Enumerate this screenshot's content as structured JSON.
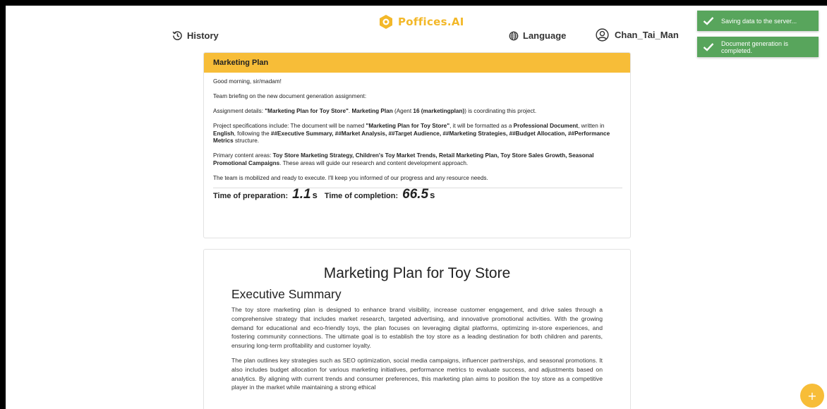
{
  "brand": {
    "name": "Poffices.AI",
    "color": "#f3b829"
  },
  "nav": {
    "history_label": "History",
    "language_label": "Language",
    "user_name": "Chan_Tai_Man"
  },
  "toasts": [
    {
      "message": "Saving data to the server...",
      "color": "#58a55c"
    },
    {
      "message": "Document generation is completed.",
      "color": "#58a55c"
    }
  ],
  "briefing": {
    "title": "Marketing Plan",
    "greeting": "Good morning, sir/madam!",
    "intro": "Team briefing on the new document generation assignment:",
    "assignment": {
      "prefix": "Assignment details: ",
      "name": "\"Marketing Plan for Toy Store\"",
      "mid": ". ",
      "agent": "Marketing Plan",
      "agent_pre": " (Agent ",
      "agent_id": "16 (marketingplan)",
      "suffix": ") is coordinating this project."
    },
    "specs": {
      "p1": "Project specifications include: The document will be named ",
      "doc_name": "\"Marketing Plan for Toy Store\"",
      "p2": ", it will be formatted as a ",
      "format": "Professional Document",
      "p3": ", written in ",
      "language": "English",
      "p4": ", following the ",
      "structure": "##Executive Summary, ##Market Analysis, ##Target Audience, ##Marketing Strategies, ##Budget Allocation, ##Performance Metrics",
      "p5": " structure."
    },
    "content_areas": {
      "prefix": "Primary content areas: ",
      "areas": "Toy Store Marketing Strategy, Children's Toy Market Trends, Retail Marketing Plan, Toy Store Sales Growth, Seasonal Promotional Campaigns",
      "suffix": ". These areas will guide our research and content development approach."
    },
    "closing": "The team is mobilized and ready to execute. I'll keep you informed of our progress and any resource needs.",
    "timing": {
      "prep_label": "Time of preparation:",
      "prep_value": "1.1",
      "prep_unit": "s",
      "completion_label": "Time of completion:",
      "completion_value": "66.5",
      "completion_unit": "s"
    }
  },
  "document": {
    "title": "Marketing Plan for Toy Store",
    "section_heading": "Executive Summary",
    "paragraphs": [
      "The toy store marketing plan is designed to enhance brand visibility, increase customer engagement, and drive sales through a comprehensive strategy that includes market research, targeted advertising, and innovative promotional activities. With the growing demand for educational and eco-friendly toys, the plan focuses on leveraging digital platforms, optimizing in-store experiences, and fostering community connections. The ultimate goal is to establish the toy store as a leading destination for both children and parents, ensuring long-term profitability and customer loyalty.",
      "The plan outlines key strategies such as SEO optimization, social media campaigns, influencer partnerships, and seasonal promotions. It also includes budget allocation for various marketing initiatives, performance metrics to evaluate success, and adjustments based on analytics. By aligning with current trends and consumer preferences, this marketing plan aims to position the toy store as a competitive player in the market while maintaining a strong ethical"
    ]
  },
  "fab": {
    "label": "+",
    "color": "#f7bd38"
  }
}
